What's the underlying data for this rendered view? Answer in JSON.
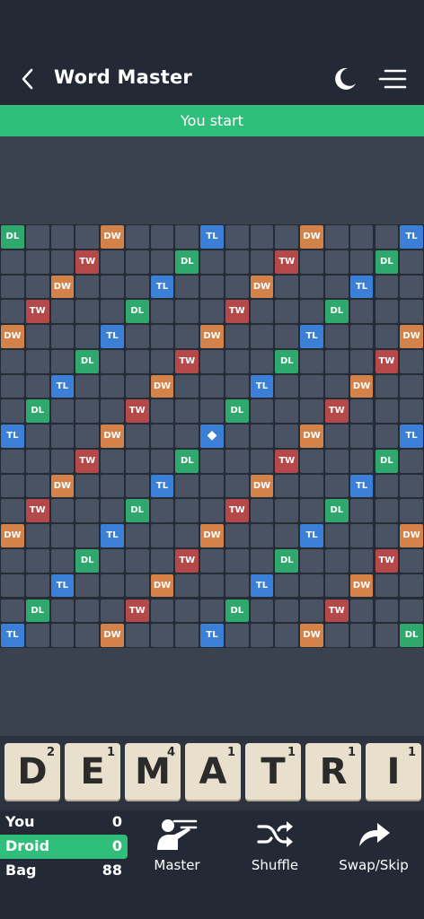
{
  "header": {
    "title": "Word Master",
    "back_icon": "chevron-left-icon",
    "theme_icon": "moon-icon",
    "menu_icon": "hamburger-menu-icon"
  },
  "status": {
    "text": "You start"
  },
  "board": {
    "size": 15,
    "center_symbol": "◆",
    "rows": [
      [
        "DL",
        "",
        "",
        "",
        "DW",
        "",
        "",
        "",
        "TL",
        "",
        "",
        "",
        "DW",
        "",
        "",
        "",
        "TL"
      ],
      [
        "",
        "",
        "",
        "TW",
        "",
        "",
        "",
        "DL",
        "",
        "",
        "",
        "TW",
        "",
        "",
        "",
        "DL",
        ""
      ],
      [
        "",
        "",
        "DW",
        "",
        "",
        "",
        "TL",
        "",
        "",
        "",
        "DW",
        "",
        "",
        "",
        "TL",
        "",
        ""
      ],
      [
        "",
        "TW",
        "",
        "",
        "",
        "DL",
        "",
        "",
        "",
        "TW",
        "",
        "",
        "",
        "DL",
        "",
        "",
        ""
      ],
      [
        "DW",
        "",
        "",
        "",
        "TL",
        "",
        "",
        "",
        "DW",
        "",
        "",
        "",
        "TL",
        "",
        "",
        "",
        "DW"
      ],
      [
        "",
        "",
        "",
        "DL",
        "",
        "",
        "",
        "TW",
        "",
        "",
        "",
        "DL",
        "",
        "",
        "",
        "TW",
        ""
      ],
      [
        "",
        "",
        "TL",
        "",
        "",
        "",
        "DW",
        "",
        "",
        "",
        "TL",
        "",
        "",
        "",
        "DW",
        "",
        ""
      ],
      [
        "",
        "DL",
        "",
        "",
        "",
        "TW",
        "",
        "",
        "",
        "DL",
        "",
        "",
        "",
        "TW",
        "",
        "",
        ""
      ],
      [
        "TL",
        "",
        "",
        "",
        "DW",
        "",
        "",
        "",
        "*",
        "",
        "",
        "",
        "DW",
        "",
        "",
        "",
        "TL"
      ],
      [
        "",
        "",
        "",
        "TW",
        "",
        "",
        "",
        "DL",
        "",
        "",
        "",
        "TW",
        "",
        "",
        "",
        "DL",
        ""
      ],
      [
        "",
        "",
        "DW",
        "",
        "",
        "",
        "TL",
        "",
        "",
        "",
        "DW",
        "",
        "",
        "",
        "TL",
        "",
        ""
      ],
      [
        "",
        "TW",
        "",
        "",
        "",
        "DL",
        "",
        "",
        "",
        "TW",
        "",
        "",
        "",
        "DL",
        "",
        "",
        ""
      ],
      [
        "DW",
        "",
        "",
        "",
        "TL",
        "",
        "",
        "",
        "DW",
        "",
        "",
        "",
        "TL",
        "",
        "",
        "",
        "DW"
      ],
      [
        "",
        "",
        "",
        "DL",
        "",
        "",
        "",
        "TW",
        "",
        "",
        "",
        "DL",
        "",
        "",
        "",
        "TW",
        ""
      ],
      [
        "",
        "",
        "TL",
        "",
        "",
        "",
        "DW",
        "",
        "",
        "",
        "TL",
        "",
        "",
        "",
        "DW",
        "",
        ""
      ],
      [
        "",
        "DL",
        "",
        "",
        "",
        "TW",
        "",
        "",
        "",
        "DL",
        "",
        "",
        "",
        "TW",
        "",
        "",
        ""
      ],
      [
        "TL",
        "",
        "",
        "",
        "DW",
        "",
        "",
        "",
        "TL",
        "",
        "",
        "",
        "DW",
        "",
        "",
        "",
        "DL"
      ]
    ]
  },
  "rack": {
    "tiles": [
      {
        "letter": "D",
        "points": "2"
      },
      {
        "letter": "E",
        "points": "1"
      },
      {
        "letter": "M",
        "points": "4"
      },
      {
        "letter": "A",
        "points": "1"
      },
      {
        "letter": "T",
        "points": "1"
      },
      {
        "letter": "R",
        "points": "1"
      },
      {
        "letter": "I",
        "points": "1"
      }
    ]
  },
  "scores": {
    "you": {
      "label": "You",
      "value": "0"
    },
    "droid": {
      "label": "Droid",
      "value": "0"
    },
    "bag": {
      "label": "Bag",
      "value": "88"
    }
  },
  "actions": {
    "master": {
      "label": "Master",
      "icon": "teacher-icon"
    },
    "shuffle": {
      "label": "Shuffle",
      "icon": "shuffle-icon"
    },
    "swap": {
      "label": "Swap/Skip",
      "icon": "share-arrow-icon"
    }
  },
  "colors": {
    "DL": "#2fa86e",
    "TL": "#3b7fd6",
    "DW": "#d3824a",
    "TW": "#b54848",
    "accent": "#2fbf7a",
    "tile": "#e8dfcc"
  }
}
